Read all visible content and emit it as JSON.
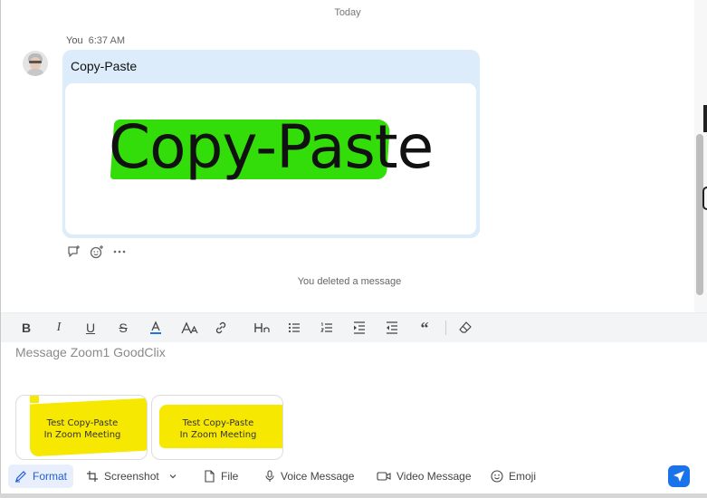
{
  "chat": {
    "date_divider": "Today",
    "message": {
      "sender": "You",
      "time": "6:37 AM",
      "text": "Copy-Paste",
      "image_text": "Copy-Paste",
      "highlight_color": "#33dd0a",
      "bubble_color": "#dcecfb"
    },
    "actions": [
      "reply-icon",
      "add-reaction-icon",
      "more-icon"
    ],
    "deleted_notice": "You deleted a message"
  },
  "format_toolbar": {
    "items": [
      "bold",
      "italic",
      "underline",
      "strikethrough",
      "font-color",
      "font-size",
      "link",
      "heading",
      "bulleted-list",
      "numbered-list",
      "indent",
      "outdent",
      "quote",
      "clear-format"
    ]
  },
  "composer": {
    "placeholder": "Message Zoom1 GoodClix",
    "attachments": [
      {
        "line1": "Test Copy-Paste",
        "line2": "In Zoom Meeting"
      },
      {
        "line1": "Test Copy-Paste",
        "line2": "In Zoom Meeting"
      }
    ],
    "attachment_highlight": "#f6e800"
  },
  "bottom_toolbar": {
    "format": "Format",
    "screenshot": "Screenshot",
    "file": "File",
    "voice": "Voice Message",
    "video": "Video Message",
    "emoji": "Emoji"
  },
  "accent": "#1a73e8"
}
